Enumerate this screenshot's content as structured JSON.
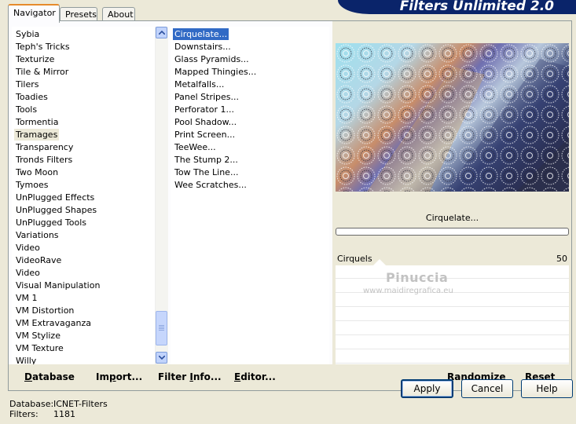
{
  "banner": {
    "title": "Filters Unlimited 2.0"
  },
  "tabs": [
    {
      "label": "Navigator",
      "active": true
    },
    {
      "label": "Presets",
      "active": false
    },
    {
      "label": "About",
      "active": false
    }
  ],
  "categories": {
    "items": [
      "Sybia",
      "Teph's Tricks",
      "Texturize",
      "Tile & Mirror",
      "Tilers",
      "Toadies",
      "Tools",
      "Tormentia",
      "Tramages",
      "Transparency",
      "Tronds Filters",
      "Two Moon",
      "Tymoes",
      "UnPlugged Effects",
      "UnPlugged Shapes",
      "UnPlugged Tools",
      "Variations",
      "Video",
      "VideoRave",
      "Video",
      "Visual Manipulation",
      "VM 1",
      "VM Distortion",
      "VM Extravaganza",
      "VM Stylize",
      "VM Texture",
      "Willy"
    ],
    "selected_index": 8
  },
  "filters": {
    "items": [
      "Cirquelate...",
      "Downstairs...",
      "Glass Pyramids...",
      "Mapped Thingies...",
      "Metalfalls...",
      "Panel Stripes...",
      "Perforator 1...",
      "Pool Shadow...",
      "Print Screen...",
      "TeeWee...",
      "The Stump 2...",
      "Tow The Line...",
      "Wee Scratches..."
    ],
    "selected_index": 0
  },
  "preview": {
    "filter_name": "Cirquelate..."
  },
  "params": [
    {
      "label": "Cirquels",
      "value": "50"
    }
  ],
  "watermark": {
    "name": "Pinuccia",
    "url": "www.maidiregrafica.eu"
  },
  "buttons": {
    "database": {
      "pre": "",
      "u": "D",
      "post": "atabase"
    },
    "import": {
      "pre": "Im",
      "u": "p",
      "post": "ort..."
    },
    "filterinfo": {
      "pre": "Filter ",
      "u": "I",
      "post": "nfo..."
    },
    "editor": {
      "pre": "",
      "u": "E",
      "post": "ditor..."
    },
    "randomize": "Randomize",
    "reset": "Reset",
    "apply": "Apply",
    "cancel": "Cancel",
    "help": "Help"
  },
  "status": {
    "database_label": "Database:",
    "database_value": "ICNET-Filters",
    "filters_label": "Filters:",
    "filters_value": "1181"
  },
  "colors": {
    "selection": "#316ac5",
    "banner": "#0a246a",
    "tab_accent": "#e68b2c"
  }
}
